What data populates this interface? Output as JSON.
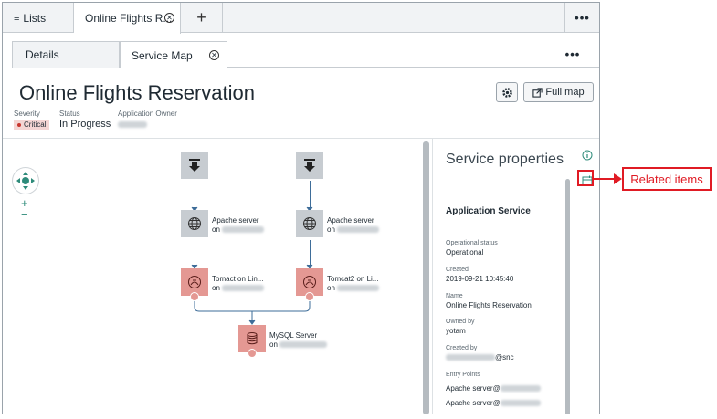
{
  "tabs": {
    "lists_label": "Lists",
    "active_label": "Online Flights R...",
    "plus_label": "+",
    "menu": "•••"
  },
  "subtabs": {
    "details_label": "Details",
    "service_map_label": "Service Map",
    "menu": "•••"
  },
  "header": {
    "title": "Online Flights Reservation",
    "full_map_label": "Full map",
    "severity_label": "Severity",
    "severity_value": "Critical",
    "status_label": "Status",
    "status_value": "In Progress",
    "owner_label": "Application Owner"
  },
  "map": {
    "zoom_in": "+",
    "zoom_out": "−",
    "nodes": [
      {
        "name": "Apache server",
        "on": "on"
      },
      {
        "name": "Apache server",
        "on": "on"
      },
      {
        "name": "Tomact on Lin...",
        "on": "on"
      },
      {
        "name": "Tomcat2 on Li...",
        "on": "on"
      },
      {
        "name": "MySQL Server",
        "on": "on"
      }
    ]
  },
  "properties": {
    "title": "Service properties",
    "section": "Application Service",
    "fields": [
      {
        "label": "Operational status",
        "value": "Operational"
      },
      {
        "label": "Created",
        "value": "2019-09-21 10:45:40"
      },
      {
        "label": "Name",
        "value": "Online Flights Reservation"
      },
      {
        "label": "Owned by",
        "value": "yotam"
      },
      {
        "label": "Created by",
        "value": "@snc"
      }
    ],
    "entry_points_label": "Entry Points",
    "entry_points": [
      "Apache server@",
      "Apache server@"
    ]
  },
  "callout": {
    "label": "Related items"
  },
  "colors": {
    "accent": "#2e8b7a",
    "critical": "#c8362e",
    "node_red": "#e49893",
    "node_grey": "#c7ccd1",
    "callout": "#e01b24"
  },
  "icons": [
    "list-icon",
    "close-icon",
    "gear-icon",
    "external-link-icon",
    "download-arrow-icon",
    "globe-icon",
    "server-globe-icon",
    "database-icon",
    "info-icon",
    "calendar-icon"
  ]
}
